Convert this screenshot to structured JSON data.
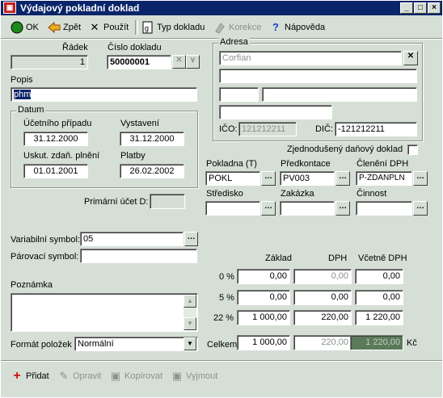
{
  "window": {
    "title": "Výdajový pokladní doklad"
  },
  "toolbar": {
    "ok": "OK",
    "back": "Zpět",
    "apply": "Použít",
    "doc_type": "Typ dokladu",
    "correction": "Korekce",
    "help": "Nápověda"
  },
  "header": {
    "row_label": "Řádek",
    "row_value": "1",
    "docnum_label": "Číslo dokladu",
    "docnum_value": "50000001"
  },
  "description": {
    "label": "Popis",
    "value": "phm"
  },
  "dates": {
    "group_title": "Datum",
    "case_label": "Účetního případu",
    "case_value": "31.12.2000",
    "issued_label": "Vystavení",
    "issued_value": "31.12.2000",
    "tax_label": "Uskut. zdaň. plnění",
    "tax_value": "01.01.2001",
    "payment_label": "Platby",
    "payment_value": "26.02.2002"
  },
  "address": {
    "group_title": "Adresa",
    "name": "Corfian",
    "ico_label": "IČO:",
    "ico_value": "121212211",
    "dic_label": "DIČ:",
    "dic_value": "-121212211"
  },
  "simplified": {
    "label": "Zjednodušený daňový doklad"
  },
  "accounts": {
    "cash_label": "Pokladna (T)",
    "cash_value": "POKL",
    "precontract_label": "Předkontace",
    "precontract_value": "PV003",
    "vat_label": "Členění DPH",
    "vat_value": "P-ZDANPLN",
    "center_label": "Středisko",
    "order_label": "Zakázka",
    "activity_label": "Činnost",
    "primary_label": "Primární účet D:"
  },
  "symbols": {
    "variable_label": "Variabilní symbol:",
    "variable_value": "05",
    "pairing_label": "Párovací symbol:"
  },
  "note": {
    "label": "Poznámka"
  },
  "format": {
    "label": "Formát položek",
    "value": "Normální"
  },
  "totals": {
    "base_header": "Základ",
    "vat_header": "DPH",
    "incl_header": "Včetně DPH",
    "rows": [
      {
        "rate": "0 %",
        "base": "0,00",
        "vat": "0,00",
        "incl": "0,00"
      },
      {
        "rate": "5 %",
        "base": "0,00",
        "vat": "0,00",
        "incl": "0,00"
      },
      {
        "rate": "22 %",
        "base": "1 000,00",
        "vat": "220,00",
        "incl": "1 220,00"
      }
    ],
    "total_label": "Celkem",
    "total_base": "1 000,00",
    "total_vat": "220,00",
    "total_incl": "1 220,00",
    "currency": "Kč"
  },
  "items_toolbar": {
    "add": "Přidat",
    "edit": "Opravit",
    "copy": "Kopírovat",
    "cut": "Vyjmout"
  }
}
